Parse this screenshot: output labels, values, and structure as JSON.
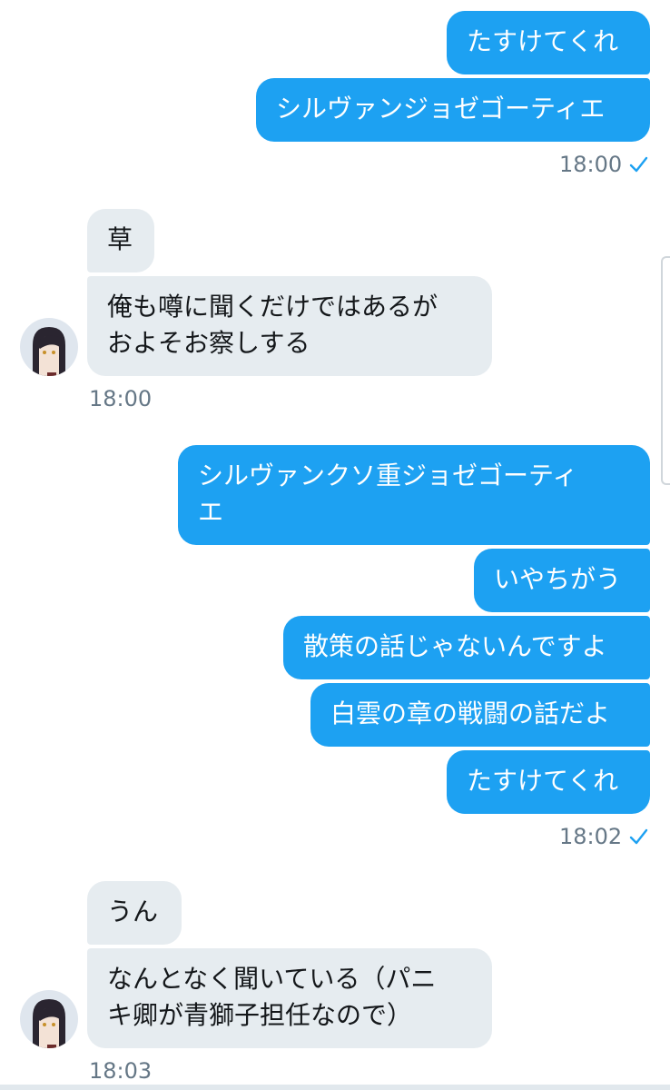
{
  "conversation": {
    "group1": {
      "messages": [
        "たすけてくれ",
        "シルヴァンジョゼゴーティエ"
      ],
      "time": "18:00",
      "read_icon": "checkmark-icon"
    },
    "group2": {
      "messages": [
        "草",
        "俺も噂に聞くだけではあるが\nおよそお察しする"
      ],
      "time": "18:00",
      "avatar_icon": "avatar"
    },
    "group3": {
      "messages": [
        "シルヴァンクソ重ジョゼゴーティ\nエ",
        "いやちがう",
        "散策の話じゃないんですよ",
        "白雲の章の戦闘の話だよ",
        "たすけてくれ"
      ],
      "time": "18:02",
      "read_icon": "checkmark-icon"
    },
    "group4": {
      "messages": [
        "うん",
        "なんとなく聞いている（パニ\nキ卿が青獅子担任なので）"
      ],
      "time": "18:03",
      "avatar_icon": "avatar"
    }
  },
  "colors": {
    "sent_bubble": "#1da1f2",
    "received_bubble": "#e6ecf0",
    "timestamp": "#657786"
  }
}
